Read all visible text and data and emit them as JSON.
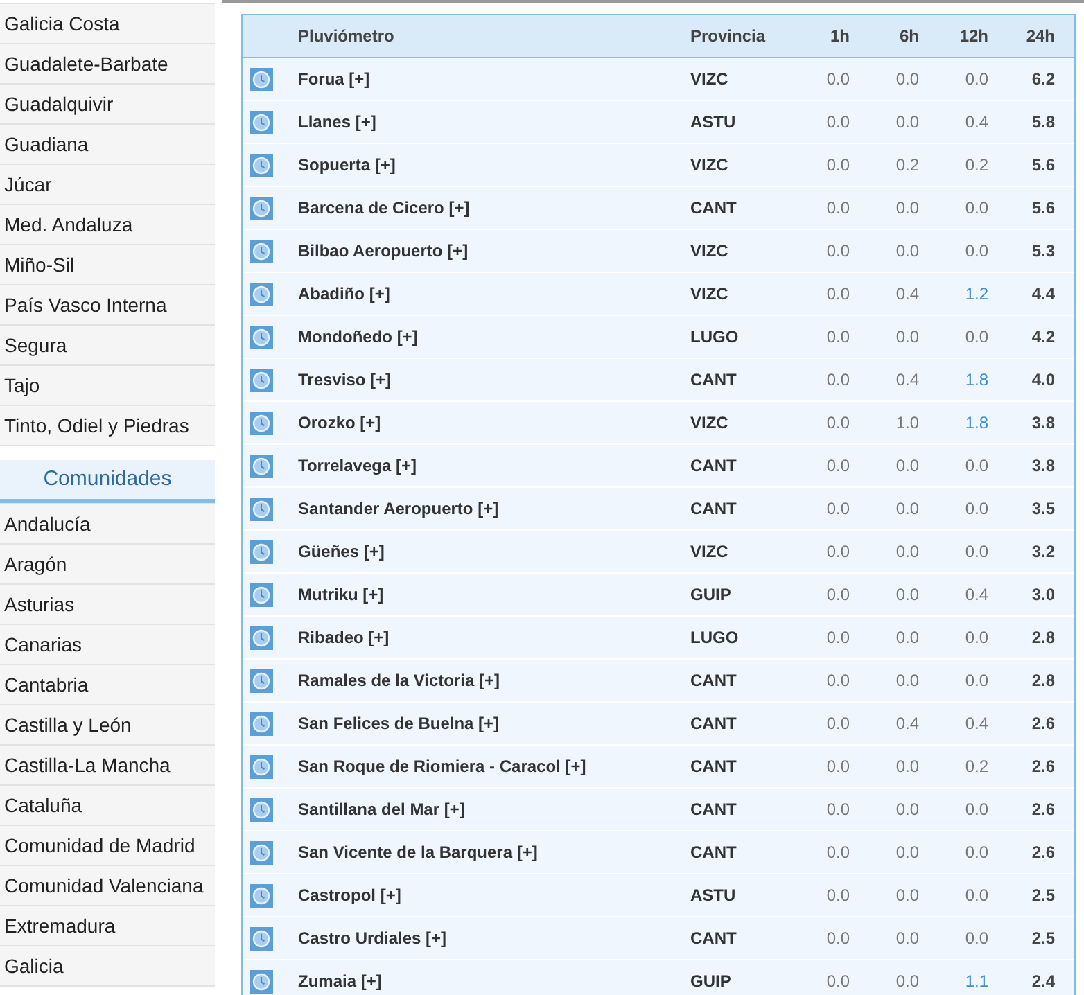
{
  "sidebar": {
    "basins": [
      "Galicia Costa",
      "Guadalete-Barbate",
      "Guadalquivir",
      "Guadiana",
      "Júcar",
      "Med. Andaluza",
      "Miño-Sil",
      "País Vasco Interna",
      "Segura",
      "Tajo",
      "Tinto, Odiel y Piedras"
    ],
    "communities_title": "Comunidades",
    "communities": [
      "Andalucía",
      "Aragón",
      "Asturias",
      "Canarias",
      "Cantabria",
      "Castilla y León",
      "Castilla-La Mancha",
      "Cataluña",
      "Comunidad de Madrid",
      "Comunidad Valenciana",
      "Extremadura",
      "Galicia"
    ]
  },
  "table": {
    "columns": [
      "Pluviómetro",
      "Provincia",
      "1h",
      "6h",
      "12h",
      "24h"
    ],
    "rows": [
      {
        "name": "Forua [+]",
        "province": "VIZC",
        "h1": "0.0",
        "h6": "0.0",
        "h12": "0.0",
        "h24": "6.2",
        "h12_high": false
      },
      {
        "name": "Llanes [+]",
        "province": "ASTU",
        "h1": "0.0",
        "h6": "0.0",
        "h12": "0.4",
        "h24": "5.8",
        "h12_high": false
      },
      {
        "name": "Sopuerta [+]",
        "province": "VIZC",
        "h1": "0.0",
        "h6": "0.2",
        "h12": "0.2",
        "h24": "5.6",
        "h12_high": false
      },
      {
        "name": "Barcena de Cicero [+]",
        "province": "CANT",
        "h1": "0.0",
        "h6": "0.0",
        "h12": "0.0",
        "h24": "5.6",
        "h12_high": false
      },
      {
        "name": "Bilbao Aeropuerto [+]",
        "province": "VIZC",
        "h1": "0.0",
        "h6": "0.0",
        "h12": "0.0",
        "h24": "5.3",
        "h12_high": false
      },
      {
        "name": "Abadiño [+]",
        "province": "VIZC",
        "h1": "0.0",
        "h6": "0.4",
        "h12": "1.2",
        "h24": "4.4",
        "h12_high": true
      },
      {
        "name": "Mondoñedo [+]",
        "province": "LUGO",
        "h1": "0.0",
        "h6": "0.0",
        "h12": "0.0",
        "h24": "4.2",
        "h12_high": false
      },
      {
        "name": "Tresviso [+]",
        "province": "CANT",
        "h1": "0.0",
        "h6": "0.4",
        "h12": "1.8",
        "h24": "4.0",
        "h12_high": true
      },
      {
        "name": "Orozko [+]",
        "province": "VIZC",
        "h1": "0.0",
        "h6": "1.0",
        "h12": "1.8",
        "h24": "3.8",
        "h12_high": true
      },
      {
        "name": "Torrelavega [+]",
        "province": "CANT",
        "h1": "0.0",
        "h6": "0.0",
        "h12": "0.0",
        "h24": "3.8",
        "h12_high": false
      },
      {
        "name": "Santander Aeropuerto [+]",
        "province": "CANT",
        "h1": "0.0",
        "h6": "0.0",
        "h12": "0.0",
        "h24": "3.5",
        "h12_high": false
      },
      {
        "name": "Güeñes [+]",
        "province": "VIZC",
        "h1": "0.0",
        "h6": "0.0",
        "h12": "0.0",
        "h24": "3.2",
        "h12_high": false
      },
      {
        "name": "Mutriku [+]",
        "province": "GUIP",
        "h1": "0.0",
        "h6": "0.0",
        "h12": "0.4",
        "h24": "3.0",
        "h12_high": false
      },
      {
        "name": "Ribadeo [+]",
        "province": "LUGO",
        "h1": "0.0",
        "h6": "0.0",
        "h12": "0.0",
        "h24": "2.8",
        "h12_high": false
      },
      {
        "name": "Ramales de la Victoria [+]",
        "province": "CANT",
        "h1": "0.0",
        "h6": "0.0",
        "h12": "0.0",
        "h24": "2.8",
        "h12_high": false
      },
      {
        "name": "San Felices de Buelna [+]",
        "province": "CANT",
        "h1": "0.0",
        "h6": "0.4",
        "h12": "0.4",
        "h24": "2.6",
        "h12_high": false
      },
      {
        "name": "San Roque de Riomiera - Caracol [+]",
        "province": "CANT",
        "h1": "0.0",
        "h6": "0.0",
        "h12": "0.2",
        "h24": "2.6",
        "h12_high": false
      },
      {
        "name": "Santillana del Mar [+]",
        "province": "CANT",
        "h1": "0.0",
        "h6": "0.0",
        "h12": "0.0",
        "h24": "2.6",
        "h12_high": false
      },
      {
        "name": "San Vicente de la Barquera [+]",
        "province": "CANT",
        "h1": "0.0",
        "h6": "0.0",
        "h12": "0.0",
        "h24": "2.6",
        "h12_high": false
      },
      {
        "name": "Castropol [+]",
        "province": "ASTU",
        "h1": "0.0",
        "h6": "0.0",
        "h12": "0.0",
        "h24": "2.5",
        "h12_high": false
      },
      {
        "name": "Castro Urdiales [+]",
        "province": "CANT",
        "h1": "0.0",
        "h6": "0.0",
        "h12": "0.0",
        "h24": "2.5",
        "h12_high": false
      },
      {
        "name": "Zumaia [+]",
        "province": "GUIP",
        "h1": "0.0",
        "h6": "0.0",
        "h12": "1.1",
        "h24": "2.4",
        "h12_high": true
      }
    ]
  }
}
